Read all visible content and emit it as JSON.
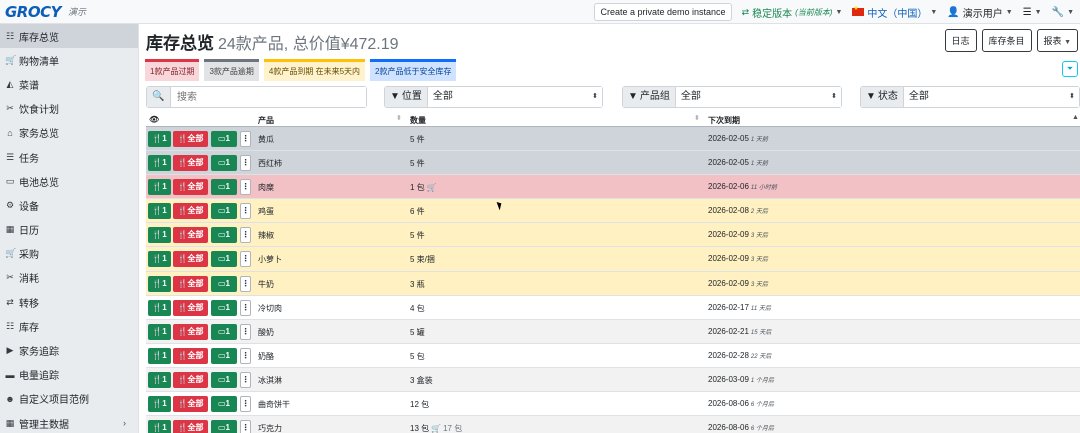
{
  "brand": {
    "name": "GROCY",
    "sub": "演示"
  },
  "topbar": {
    "demo_button": "Create a private demo instance",
    "version": "稳定版本",
    "version_note": "(当前版本)",
    "language": "中文（中国）",
    "user": "演示用户"
  },
  "sidebar": {
    "items": [
      {
        "label": "库存总览",
        "icon": "list-icon"
      },
      {
        "label": "购物清单",
        "icon": "cart-icon"
      },
      {
        "label": "菜谱",
        "icon": "pizza-icon"
      },
      {
        "label": "饮食计划",
        "icon": "utensils-icon"
      },
      {
        "label": "家务总览",
        "icon": "home-icon"
      },
      {
        "label": "任务",
        "icon": "tasks-icon"
      },
      {
        "label": "电池总览",
        "icon": "battery-icon"
      },
      {
        "label": "设备",
        "icon": "gear-icon"
      },
      {
        "label": "日历",
        "icon": "calendar-icon"
      },
      {
        "label": "采购",
        "icon": "cart-icon"
      },
      {
        "label": "消耗",
        "icon": "utensils-icon"
      },
      {
        "label": "转移",
        "icon": "exchange-icon"
      },
      {
        "label": "库存",
        "icon": "list-icon"
      },
      {
        "label": "家务追踪",
        "icon": "play-icon"
      },
      {
        "label": "电量追踪",
        "icon": "car-battery-icon"
      },
      {
        "label": "自定义项目范例",
        "icon": "smile-icon"
      },
      {
        "label": "管理主数据",
        "icon": "table-icon"
      }
    ]
  },
  "header": {
    "title": "库存总览",
    "subtitle": "24款产品, 总价值¥472.19",
    "buttons": [
      "日志",
      "库存条目",
      "报表"
    ]
  },
  "badges": [
    "1款产品过期",
    "3款产品逾期",
    "4款产品到期 在未来5天内",
    "2款产品低于安全库存"
  ],
  "filters": {
    "search_placeholder": "搜索",
    "location_label": "位置",
    "location_value": "全部",
    "group_label": "产品组",
    "group_value": "全部",
    "status_label": "状态",
    "status_value": "全部"
  },
  "table": {
    "headers": {
      "product": "产品",
      "amount": "数量",
      "due": "下次到期"
    },
    "action_labels": {
      "consume": "1",
      "consume_all": "全部",
      "open": "1"
    },
    "rows": [
      {
        "name": "黄瓜",
        "amount": "5 件",
        "date": "2026-02-05",
        "rel": "1 天前",
        "state": "expired"
      },
      {
        "name": "西红柿",
        "amount": "5 件",
        "date": "2026-02-05",
        "rel": "1 天前",
        "state": "expired"
      },
      {
        "name": "肉糜",
        "amount": "1 包",
        "date": "2026-02-06",
        "rel": "11 小时前",
        "state": "due-now",
        "cart": true
      },
      {
        "name": "鸡蛋",
        "amount": "6 件",
        "date": "2026-02-08",
        "rel": "2 天后",
        "state": "due-soon"
      },
      {
        "name": "辣椒",
        "amount": "5 件",
        "date": "2026-02-09",
        "rel": "3 天后",
        "state": "due-soon"
      },
      {
        "name": "小萝卜",
        "amount": "5 束/捆",
        "date": "2026-02-09",
        "rel": "3 天后",
        "state": "due-soon"
      },
      {
        "name": "牛奶",
        "amount": "3 瓶",
        "date": "2026-02-09",
        "rel": "3 天后",
        "state": "due-soon"
      },
      {
        "name": "冷切肉",
        "amount": "4 包",
        "date": "2026-02-17",
        "rel": "11 天后",
        "state": "normal-a"
      },
      {
        "name": "酸奶",
        "amount": "5 罐",
        "date": "2026-02-21",
        "rel": "15 天后",
        "state": "normal-b"
      },
      {
        "name": "奶酪",
        "amount": "5 包",
        "date": "2026-02-28",
        "rel": "22 天后",
        "state": "normal-a"
      },
      {
        "name": "冰淇淋",
        "amount": "3 盒装",
        "date": "2026-03-09",
        "rel": "1 个月后",
        "state": "normal-b"
      },
      {
        "name": "曲奇饼干",
        "amount": "12 包",
        "date": "2026-08-06",
        "rel": "6 个月后",
        "state": "normal-a"
      },
      {
        "name": "巧克力",
        "amount": "13 包",
        "amount_extra": "17 包",
        "date": "2026-08-06",
        "rel": "6 个月后",
        "state": "normal-b",
        "cart": true
      }
    ]
  },
  "colors": {
    "brand": "#0b5fb8",
    "success": "#198754",
    "danger": "#dc3545"
  }
}
